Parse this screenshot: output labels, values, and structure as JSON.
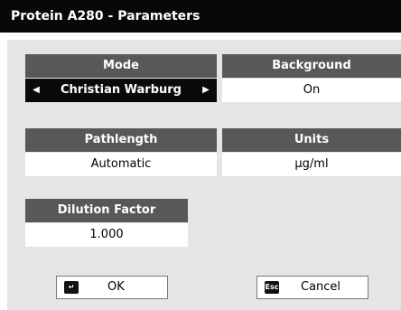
{
  "window": {
    "title": "Protein A280 - Parameters"
  },
  "params": {
    "mode": {
      "label": "Mode",
      "value": "Christian Warburg"
    },
    "background": {
      "label": "Background",
      "value": "On"
    },
    "pathlength": {
      "label": "Pathlength",
      "value": "Automatic"
    },
    "units": {
      "label": "Units",
      "value": "µg/ml"
    },
    "dilution": {
      "label": "Dilution Factor",
      "value": "1.000"
    }
  },
  "buttons": {
    "ok": {
      "label": "OK",
      "icon": "enter-key-icon"
    },
    "cancel": {
      "label": "Cancel",
      "icon": "esc-key-icon",
      "key_text": "Esc"
    }
  }
}
